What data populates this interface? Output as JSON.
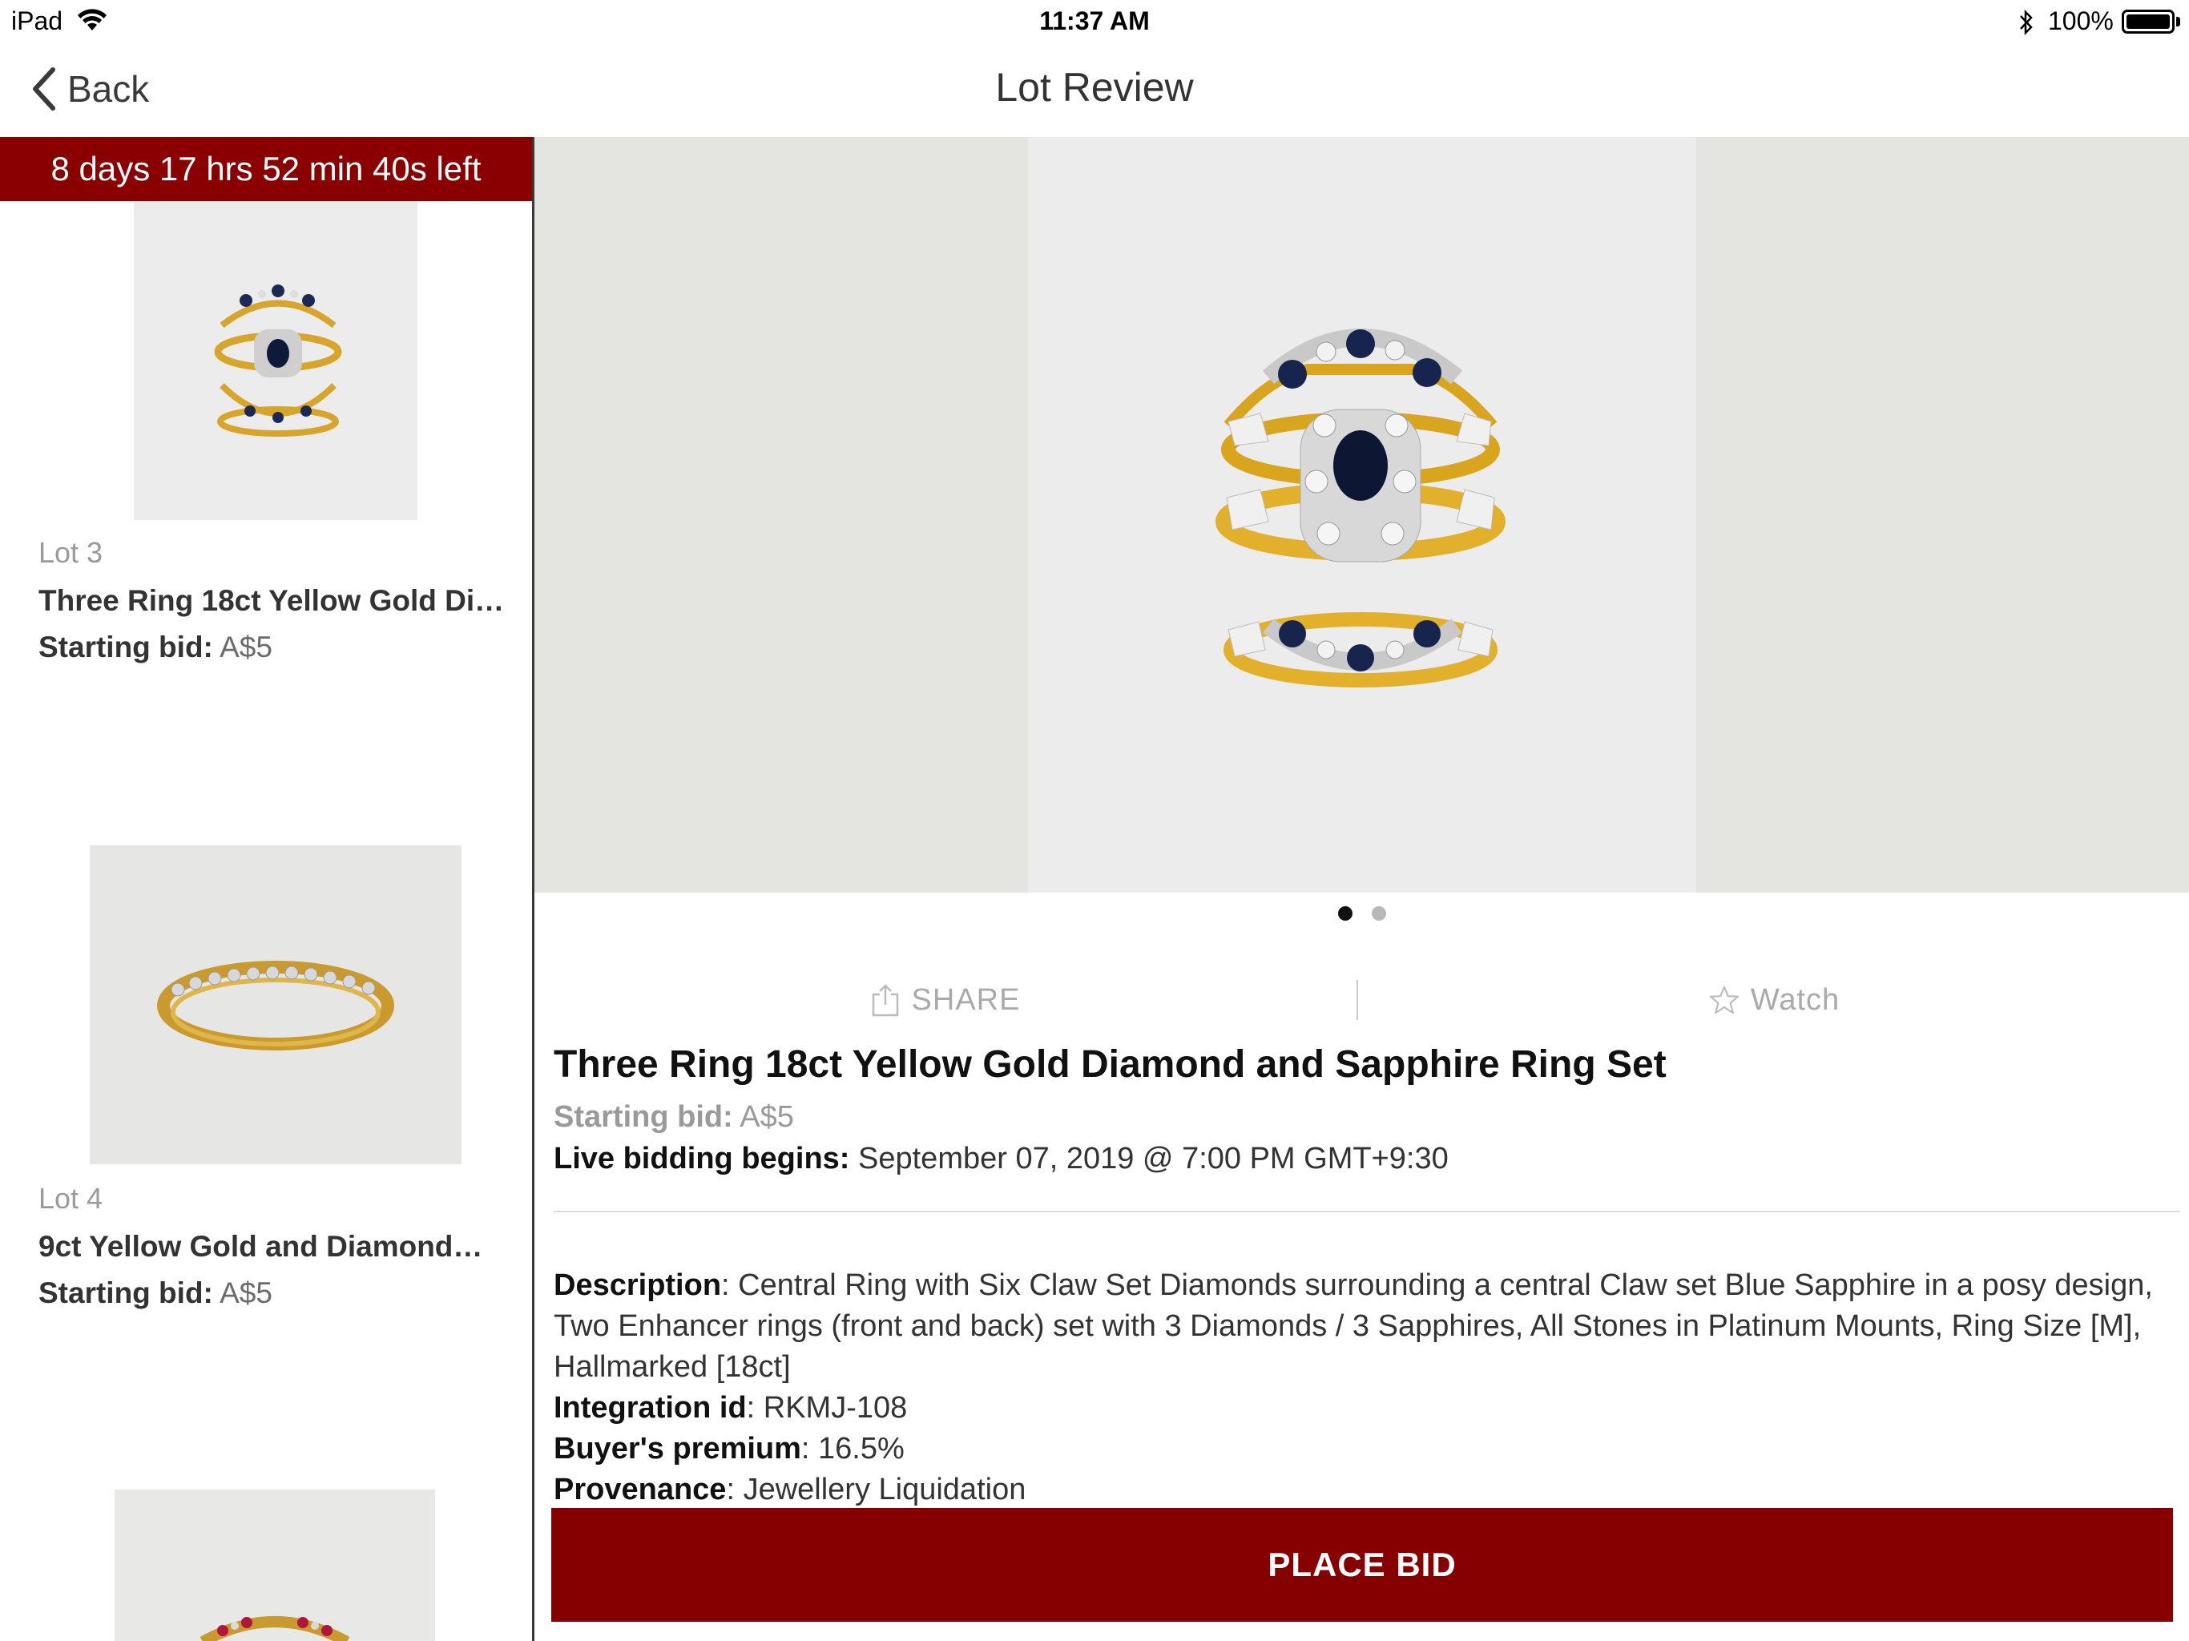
{
  "status_bar": {
    "device": "iPad",
    "time": "11:37 AM",
    "battery_pct": "100%"
  },
  "nav": {
    "back_label": "Back",
    "title": "Lot Review"
  },
  "countdown": "8 days 17 hrs 52 min 40s left",
  "lots": [
    {
      "lot_label": "Lot 3",
      "name": "Three Ring 18ct Yellow Gold Di…",
      "bid_label": "Starting bid:",
      "bid_value": "A$5",
      "image": "three-ring-set"
    },
    {
      "lot_label": "Lot 4",
      "name": "9ct Yellow Gold and Diamond…",
      "bid_label": "Starting bid:",
      "bid_value": "A$5",
      "image": "diamond-band"
    },
    {
      "image": "ruby-ring"
    }
  ],
  "detail": {
    "image_count": 2,
    "active_image": 1,
    "share_label": "SHARE",
    "watch_label": "Watch",
    "title": "Three Ring 18ct Yellow Gold Diamond and Sapphire Ring Set",
    "starting_bid_label": "Starting bid:",
    "starting_bid_value": "A$5",
    "live_bidding_label": "Live bidding begins:",
    "live_bidding_value": "September 07, 2019 @ 7:00 PM GMT+9:30",
    "description_label": "Description",
    "description_value": ": Central Ring with Six Claw Set Diamonds surrounding a central Claw set Blue Sapphire in a posy design, Two Enhancer rings (front and back) set with 3 Diamonds / 3 Sapphires, All Stones in Platinum Mounts, Ring Size [M], Hallmarked [18ct]",
    "integration_label": "Integration id",
    "integration_value": ": RKMJ-108",
    "premium_label": "Buyer's premium",
    "premium_value": ": 16.5%",
    "provenance_label": "Provenance",
    "provenance_value": ": Jewellery Liquidation"
  },
  "place_bid_label": "PLACE BID",
  "colors": {
    "accent": "#860000",
    "countdown_bg": "#8a0000"
  }
}
